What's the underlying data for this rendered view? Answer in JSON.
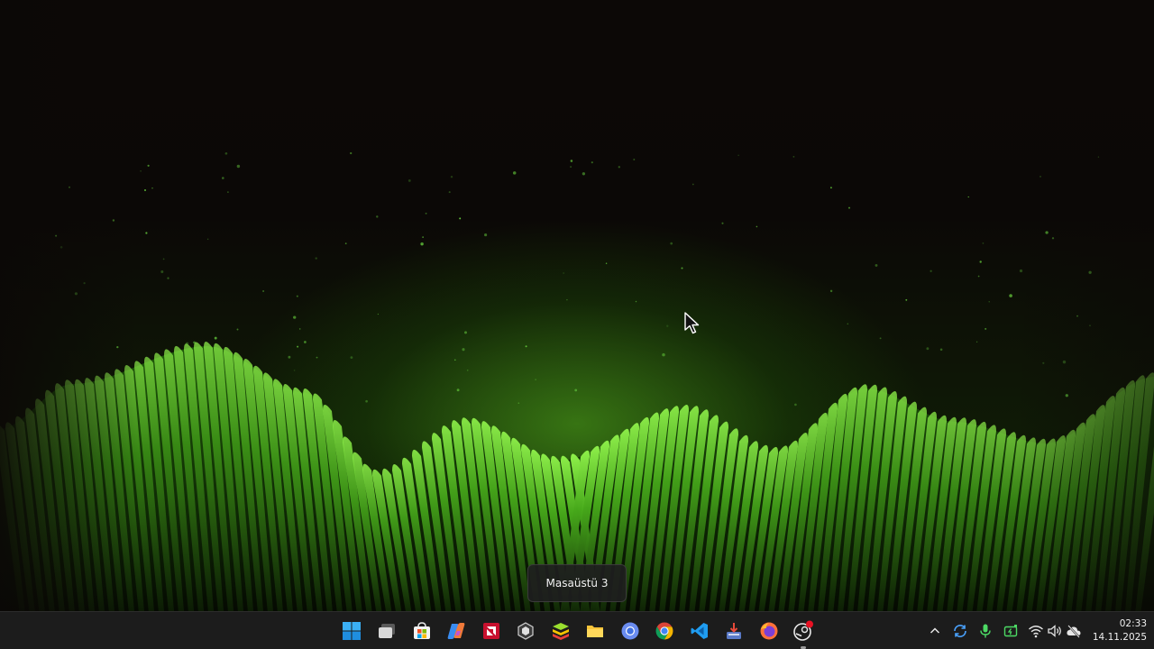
{
  "desktop": {
    "tooltip": "Masaüstü 3"
  },
  "taskbar": {
    "pinned": [
      {
        "name": "start-button",
        "icon": "windows-logo-icon"
      },
      {
        "name": "task-view-button",
        "icon": "task-view-icon"
      },
      {
        "name": "microsoft-store-button",
        "icon": "store-icon"
      },
      {
        "name": "copilot-button",
        "icon": "copilot-icon"
      },
      {
        "name": "amd-software-button",
        "icon": "amd-icon"
      },
      {
        "name": "dev-app-button",
        "icon": "cube-icon"
      },
      {
        "name": "bluestacks-button",
        "icon": "bluestacks-icon"
      },
      {
        "name": "file-explorer-button",
        "icon": "folder-icon"
      },
      {
        "name": "chromium-button",
        "icon": "chromium-icon"
      },
      {
        "name": "chrome-button",
        "icon": "chrome-icon"
      },
      {
        "name": "vscode-button",
        "icon": "vscode-icon"
      },
      {
        "name": "installer-button",
        "icon": "installer-icon"
      },
      {
        "name": "firefox-button",
        "icon": "firefox-icon"
      },
      {
        "name": "steam-button",
        "icon": "steam-icon"
      }
    ],
    "tray": {
      "icons": [
        "chevron-up-icon",
        "sync-icon",
        "microphone-icon",
        "battery-charging-icon",
        "wifi-icon",
        "volume-icon",
        "cloud-off-icon"
      ],
      "time": "02:33",
      "date": "14.11.2025"
    }
  },
  "colors": {
    "accent_green": "#5ec21a",
    "taskbar_bg": "#1c1c1c",
    "windows_blue": "#2ea4f2"
  }
}
